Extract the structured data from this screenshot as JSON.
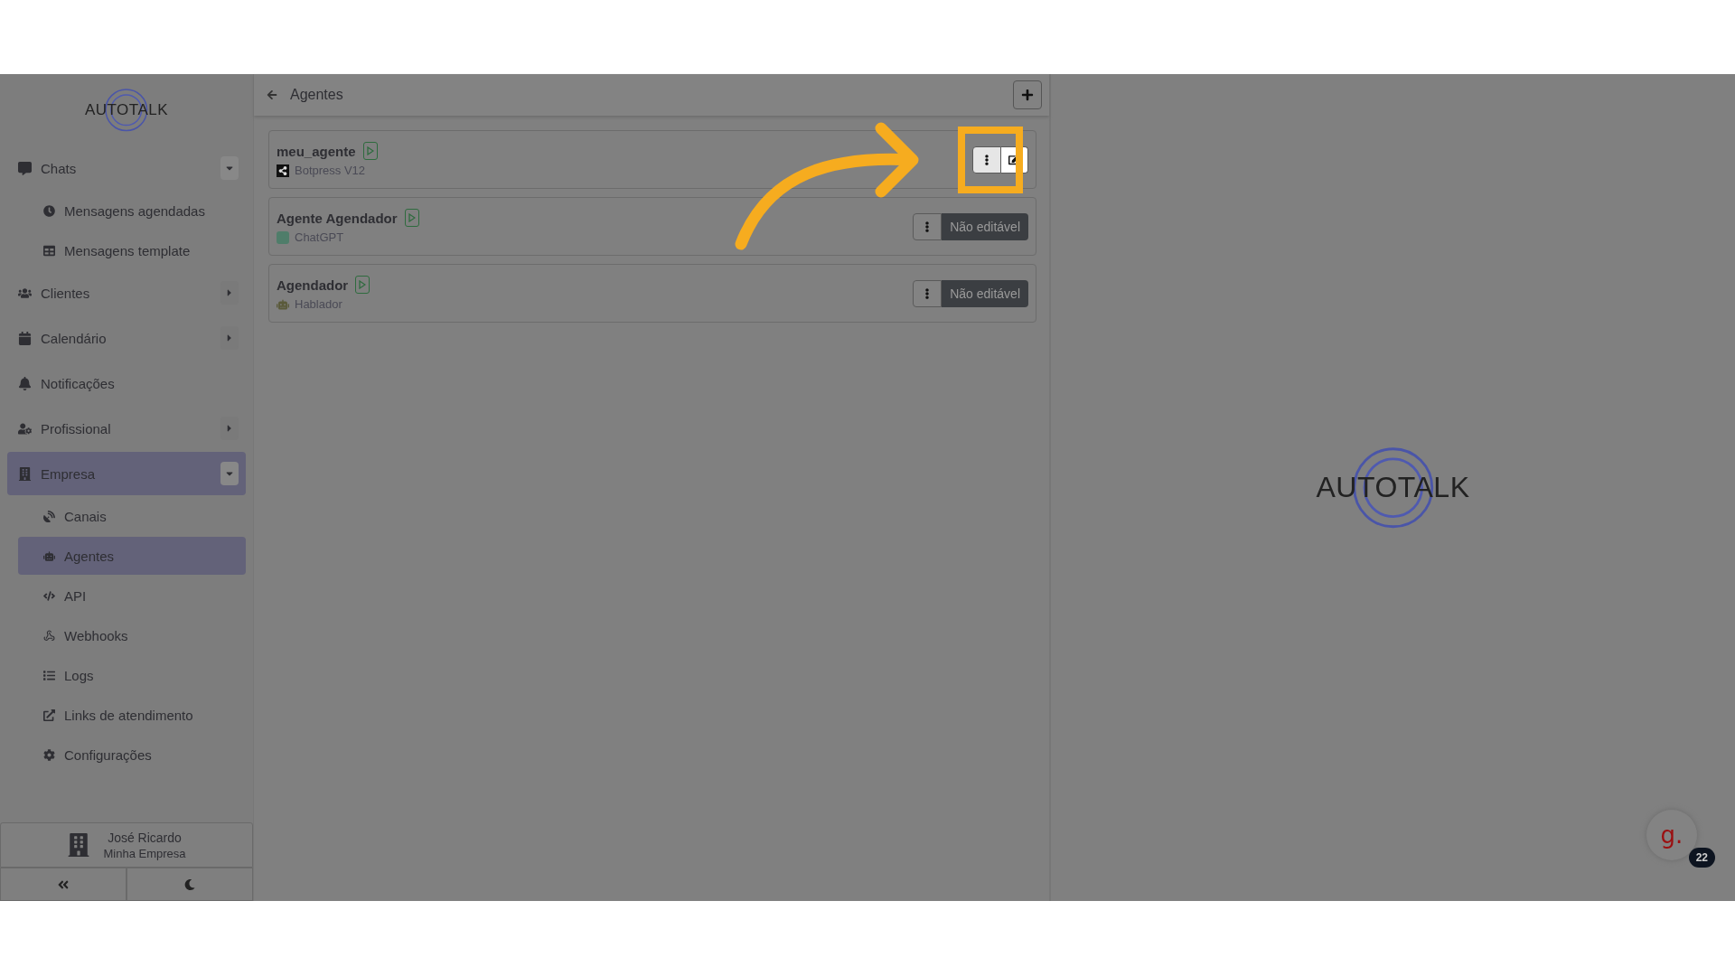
{
  "sidebar": {
    "logo": "AUTOTALK",
    "items": [
      {
        "label": "Chats",
        "expandable": true,
        "expanded": true,
        "selected": false,
        "children": [
          {
            "label": "Mensagens agendadas",
            "selected": false
          },
          {
            "label": "Mensagens template",
            "selected": false
          }
        ]
      },
      {
        "label": "Clientes",
        "expandable": true,
        "expanded": false,
        "selected": false
      },
      {
        "label": "Calendário",
        "expandable": true,
        "expanded": false,
        "selected": false
      },
      {
        "label": "Notificações",
        "expandable": false,
        "selected": false
      },
      {
        "label": "Profissional",
        "expandable": true,
        "expanded": false,
        "selected": false
      },
      {
        "label": "Empresa",
        "expandable": true,
        "expanded": true,
        "selected": true,
        "children": [
          {
            "label": "Canais",
            "selected": false
          },
          {
            "label": "Agentes",
            "selected": true
          },
          {
            "label": "API",
            "selected": false
          },
          {
            "label": "Webhooks",
            "selected": false
          },
          {
            "label": "Logs",
            "selected": false
          },
          {
            "label": "Links de atendimento",
            "selected": false
          },
          {
            "label": "Configurações",
            "selected": false
          }
        ]
      }
    ],
    "user": {
      "name": "José Ricardo",
      "company": "Minha Empresa"
    }
  },
  "header": {
    "title": "Agentes"
  },
  "agents": [
    {
      "name": "meu_agente",
      "provider": "Botpress V12",
      "kind": "botpress",
      "highlighted": true
    },
    {
      "name": "Agente Agendador",
      "provider": "ChatGPT",
      "kind": "chatgpt",
      "highlighted": false,
      "badge": "Não editável"
    },
    {
      "name": "Agendador",
      "provider": "Hablador",
      "kind": "hablador",
      "highlighted": false,
      "badge": "Não editável"
    }
  ],
  "splash": {
    "logo": "AUTOTALK"
  },
  "chat_widget": {
    "label": "g.",
    "count": "22"
  }
}
